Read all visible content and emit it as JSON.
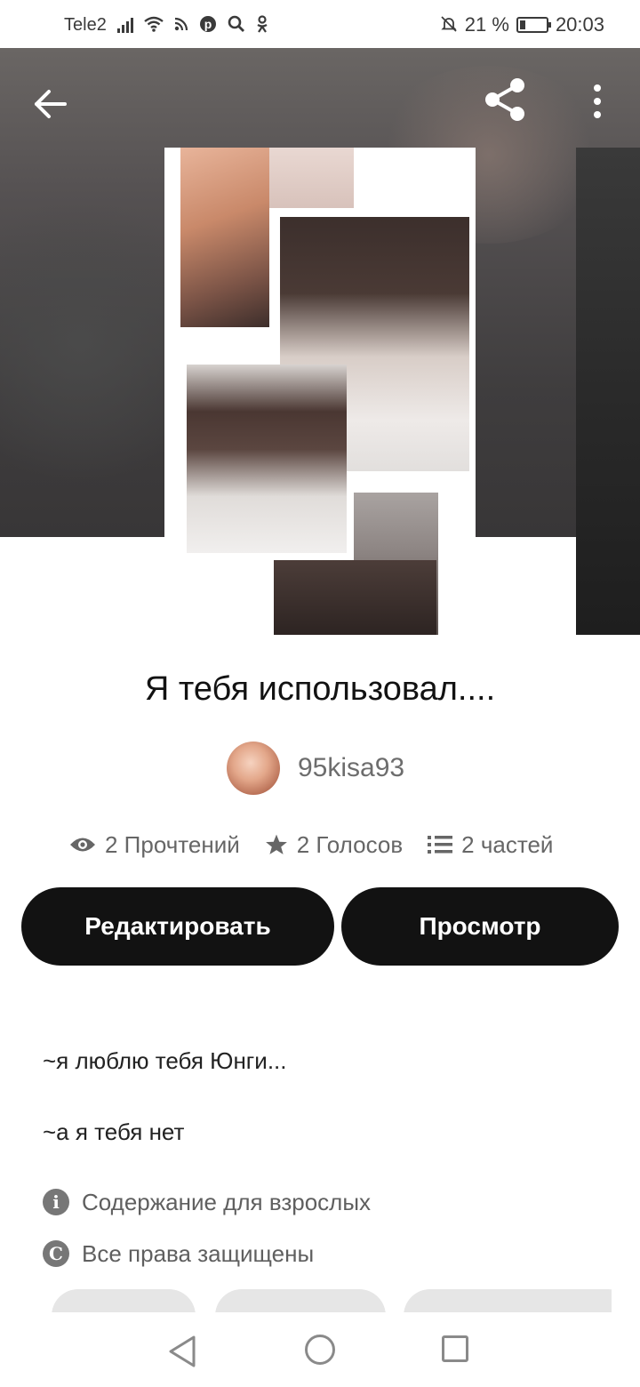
{
  "status_bar": {
    "carrier": "Tele2",
    "battery_percent": "21 %",
    "battery_level": 0.21,
    "time": "20:03",
    "icons": [
      "signal-icon",
      "wifi-icon",
      "cast-icon",
      "pinterest-icon",
      "search-icon",
      "odnoklassniki-icon",
      "bell-off-icon",
      "battery-icon"
    ]
  },
  "top_bar": {
    "icons": [
      "back-arrow-icon",
      "share-icon",
      "more-vertical-icon"
    ]
  },
  "story": {
    "title": "Я тебя использовал....",
    "author": "95kisa93"
  },
  "stats": {
    "reads": "2 Прочтений",
    "votes": "2 Голосов",
    "parts": "2 частей"
  },
  "actions": {
    "edit_label": "Редактировать",
    "view_label": "Просмотр"
  },
  "description": {
    "line1": "~я люблю тебя Юнги...",
    "line2": "~а я тебя нет"
  },
  "meta": {
    "mature": "Содержание для взрослых",
    "copyright": "Все права защищены"
  },
  "colors": {
    "button_bg": "#121212",
    "button_text": "#ffffff",
    "muted_text": "#666666"
  }
}
